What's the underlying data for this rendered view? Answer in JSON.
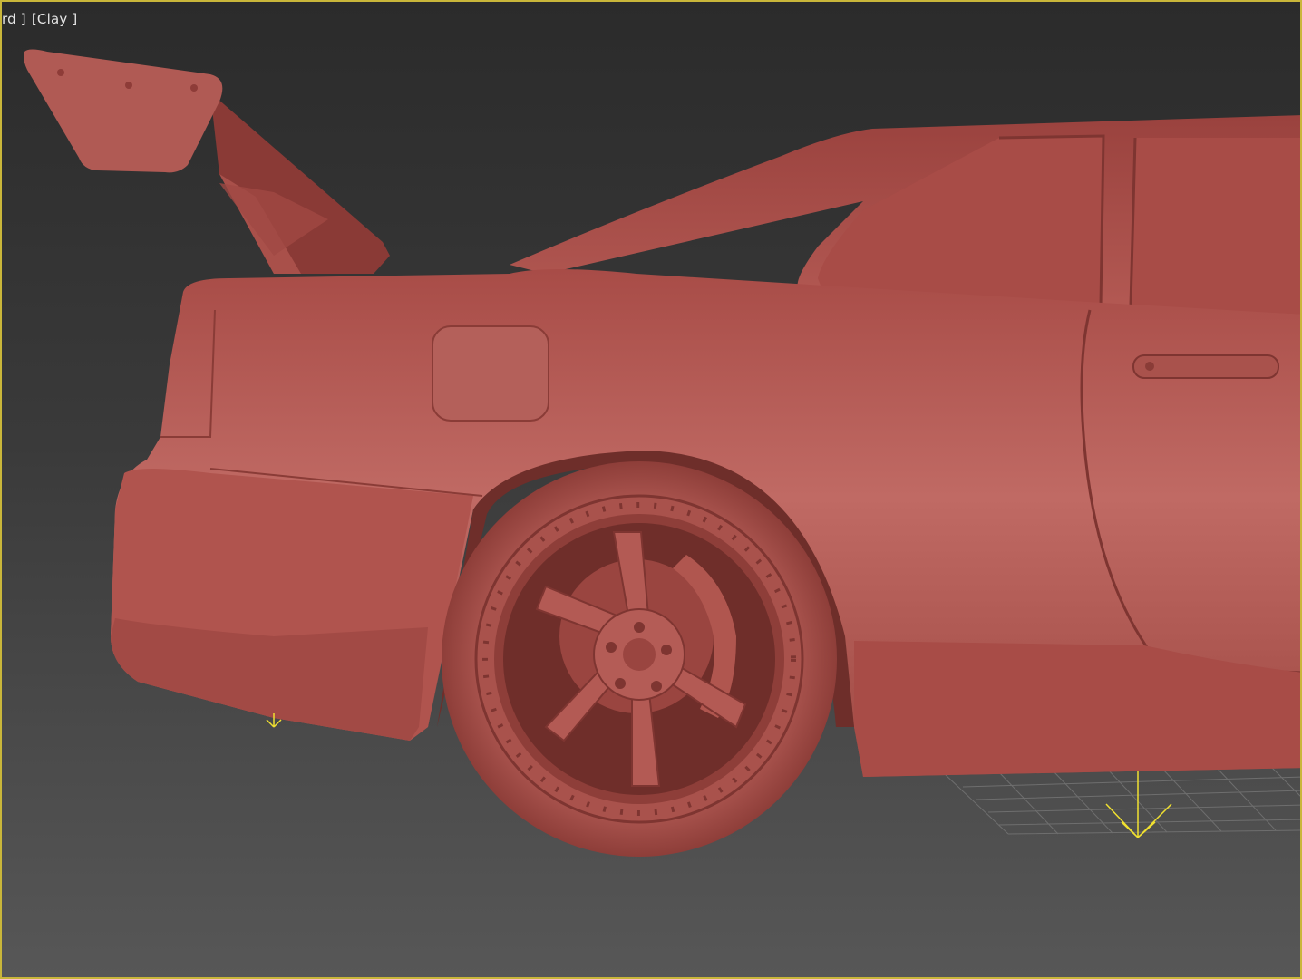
{
  "viewport": {
    "label_view": "rd ]",
    "label_shading": "[Clay ]",
    "border_color": "#c9b63a",
    "model_color": "#b85a52",
    "light_icon_color": "#f0e030"
  }
}
